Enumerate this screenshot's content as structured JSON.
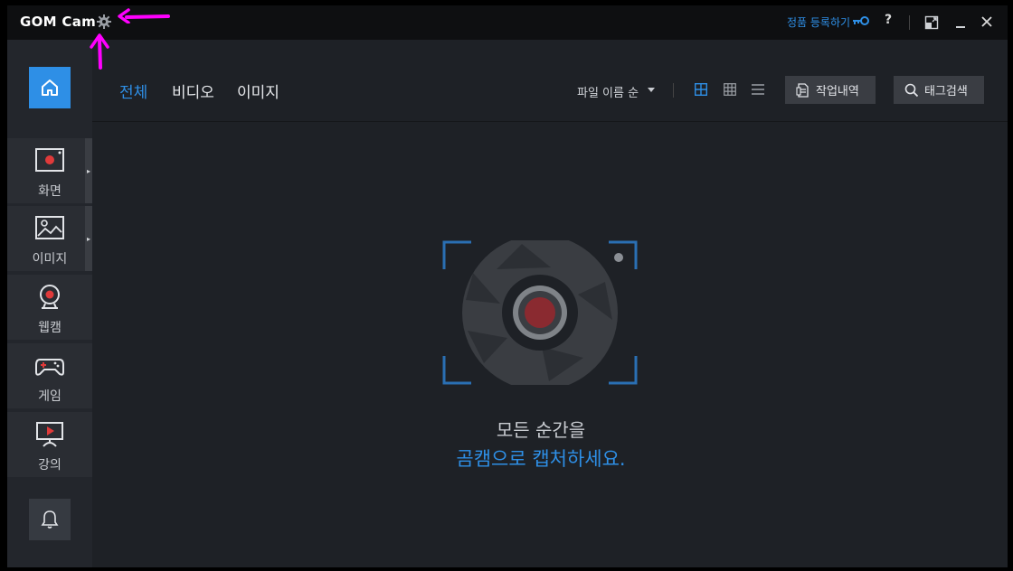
{
  "app": {
    "logo_gom": "GOM",
    "logo_cam": "Cam",
    "register_link": "정품 등록하기",
    "help_label": "?"
  },
  "sidebar": {
    "items": [
      {
        "label": "화면",
        "icon": "screen-record-icon",
        "has_submenu": true
      },
      {
        "label": "이미지",
        "icon": "image-icon",
        "has_submenu": true
      },
      {
        "label": "웹캠",
        "icon": "webcam-icon",
        "has_submenu": false
      },
      {
        "label": "게임",
        "icon": "gamepad-icon",
        "has_submenu": false
      },
      {
        "label": "강의",
        "icon": "lecture-icon",
        "has_submenu": false
      }
    ]
  },
  "tabs": [
    {
      "label": "전체",
      "active": true
    },
    {
      "label": "비디오",
      "active": false
    },
    {
      "label": "이미지",
      "active": false
    }
  ],
  "toolbar": {
    "sort_label": "파일 이름 순",
    "history_button": "작업내역",
    "tag_search_button": "태그검색"
  },
  "empty_state": {
    "line1": "모든 순간을",
    "line2": "곰캠으로 캡처하세요."
  },
  "colors": {
    "accent": "#2e8fe6",
    "annotation": "#ff00ff",
    "record_red": "#8a2a30"
  }
}
